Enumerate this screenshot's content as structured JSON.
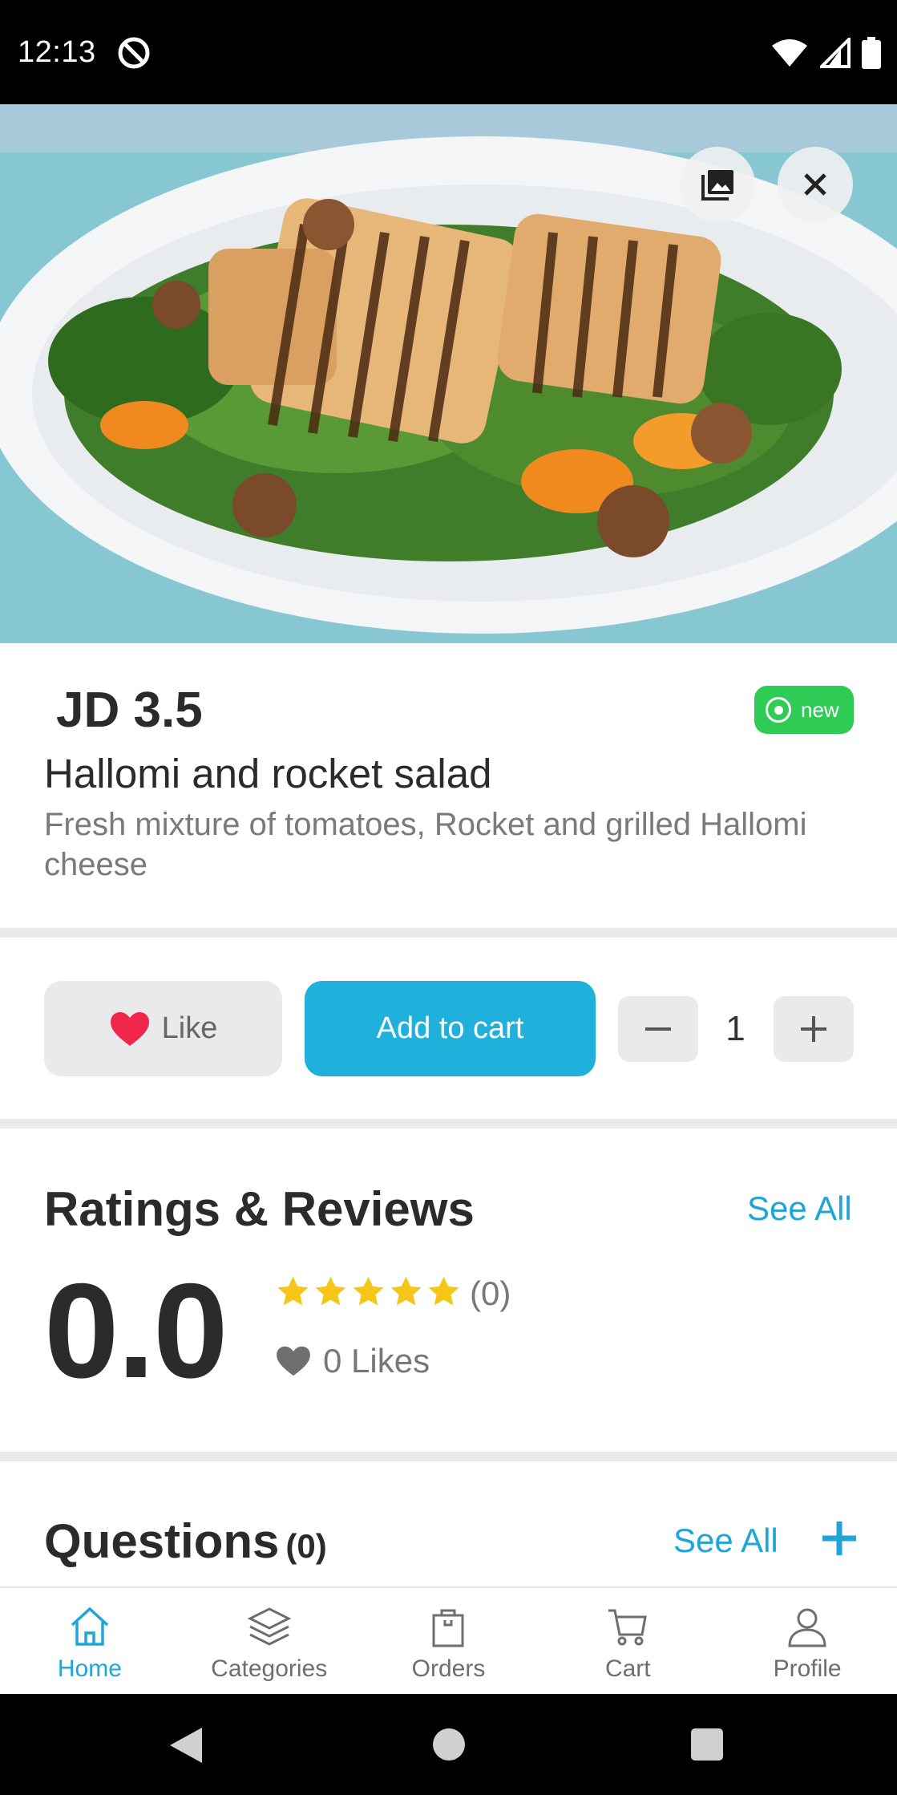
{
  "status_bar": {
    "time": "12:13"
  },
  "product": {
    "price": "JD 3.5",
    "badge": "new",
    "name": "Hallomi and rocket salad",
    "description": "Fresh mixture of tomatoes, Rocket and grilled Hallomi cheese"
  },
  "actions": {
    "like_label": "Like",
    "add_to_cart_label": "Add to cart",
    "quantity": "1"
  },
  "ratings": {
    "title": "Ratings & Reviews",
    "see_all": "See All",
    "average": "0.0",
    "count": "(0)",
    "likes": "0 Likes",
    "stars": 5
  },
  "questions": {
    "title": "Questions",
    "count": "(0)",
    "see_all": "See All"
  },
  "nav": {
    "items": [
      {
        "label": "Home",
        "icon": "home-icon",
        "active": true
      },
      {
        "label": "Categories",
        "icon": "layers-icon",
        "active": false
      },
      {
        "label": "Orders",
        "icon": "bag-icon",
        "active": false
      },
      {
        "label": "Cart",
        "icon": "cart-icon",
        "active": false
      },
      {
        "label": "Profile",
        "icon": "user-icon",
        "active": false
      }
    ]
  },
  "colors": {
    "accent": "#1fb0dc",
    "badge_green": "#2ecc55",
    "heart_red": "#f0274a",
    "star_yellow": "#f5c518"
  }
}
